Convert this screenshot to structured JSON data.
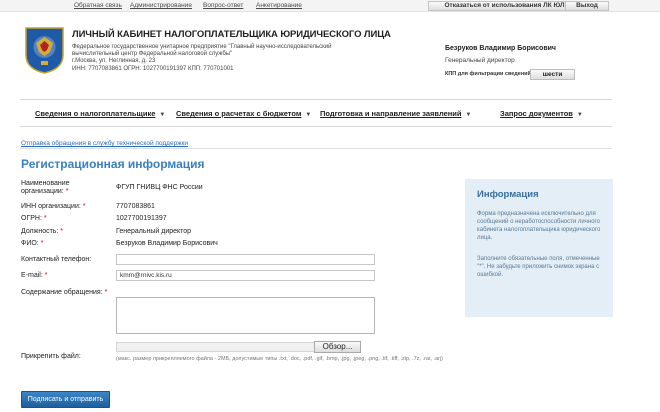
{
  "top": {
    "links": [
      "Обратная связь",
      "Администрирование",
      "Вопрос-ответ",
      "Анкетирование"
    ],
    "refuse_label": "Отказаться от использования ЛК ЮЛ",
    "exit_label": "Выход"
  },
  "header": {
    "title": "ЛИЧНЫЙ КАБИНЕТ НАЛОГОПЛАТЕЛЬЩИКА ЮРИДИЧЕСКОГО ЛИЦА",
    "org_line1": "Федеральное государственное унитарное предприятие \"Главный научно-исследовательский",
    "org_line2": "вычислительный центр Федеральной налоговой службы\"",
    "address": "г.Москва, ул. Неглинная, д. 23",
    "ids": "ИНН: 7707083861   ОГРН: 1027700191397   КПП: 770701001",
    "user_name": "Безруков Владимир Борисович",
    "user_role": "Генеральный директор",
    "npp_label": "КПП для фильтрации сведений:",
    "npp_button": "шести"
  },
  "nav": {
    "items": [
      "Сведения о налогоплательщике",
      "Сведения о расчетах с бюджетом",
      "Подготовка и направление заявлений",
      "Запрос документов"
    ]
  },
  "support_link": "Отправка обращения в службу технической поддержки",
  "page_title": "Регистрационная информация",
  "form": {
    "org_label_line1": "Наименование",
    "org_label_line2": "организации:",
    "org_value": "ФГУП ГНИВЦ ФНС России",
    "inn_label": "ИНН организации:",
    "inn_value": "7707083861",
    "ogrn_label": "ОГРН:",
    "ogrn_value": "1027700191397",
    "position_label": "Должность:",
    "position_value": "Генеральный директор",
    "fio_label": "ФИО:",
    "fio_value": "Безруков Владимир Борисович",
    "phone_label": "Контактный телефон:",
    "phone_value": "",
    "email_label": "E-mail:",
    "email_value": "kmm@rnivc.kis.ru",
    "message_label": "Содержание обращения:",
    "attach_label": "Прикрепить файл:",
    "browse_label": "Обзор...",
    "file_hint": "(макс. размер прикрепляемого файла - 2МБ, допустимые типы .txt, .doc, .pdf, .gif, .bmp, .jpg, .jpeg, .png, .tif, .tiff, .zip, .7z, .rar, .arj)",
    "submit_label": "Подписать и отправить",
    "required_mark": "*"
  },
  "info": {
    "title": "Информация",
    "text1": "Форма предназначена исключительно для сообщений о неработоспособности личного кабинета налогоплательщика юридического лица.",
    "text2": "Заполните обязательные поля, отмеченные \"*\". Не забудьте приложить снимок экрана с ошибкой."
  },
  "colors": {
    "accent": "#3a7fbf",
    "submit": "#2a6fae",
    "info_bg": "#e3eef7",
    "required": "#cc0000"
  },
  "icons": {
    "emblem": "fns-emblem-icon",
    "nav_chevron": "chevron-down-icon"
  }
}
